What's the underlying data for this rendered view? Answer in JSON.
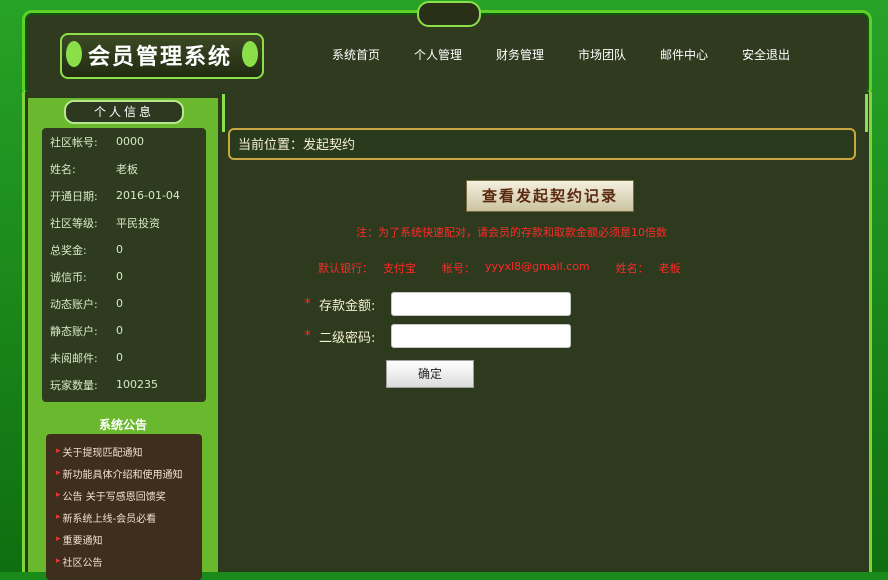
{
  "header": {
    "logo_text": "会员管理系统",
    "nav": [
      "系统首页",
      "个人管理",
      "财务管理",
      "市场团队",
      "邮件中心",
      "安全退出"
    ]
  },
  "sidebar": {
    "title": "个人信息",
    "info": [
      {
        "label": "社区帐号:",
        "value": "0000"
      },
      {
        "label": "姓名:",
        "value": "老板"
      },
      {
        "label": "开通日期:",
        "value": "2016-01-04"
      },
      {
        "label": "社区等级:",
        "value": "平民投资"
      },
      {
        "label": "总奖金:",
        "value": "0"
      },
      {
        "label": "诚信币:",
        "value": "0"
      },
      {
        "label": "动态账户:",
        "value": "0"
      },
      {
        "label": "静态账户:",
        "value": "0"
      },
      {
        "label": "未阅邮件:",
        "value": "0"
      },
      {
        "label": "玩家数量:",
        "value": "100235"
      }
    ],
    "notice_title": "系统公告",
    "notices": [
      "关于提现匹配通知",
      "新功能具体介绍和使用通知",
      "公告 关于写感恩回馈奖",
      "新系统上线-会员必看",
      "重要通知",
      "社区公告"
    ]
  },
  "content": {
    "breadcrumb": "当前位置：发起契约",
    "record_button": "查看发起契约记录",
    "note": "注：为了系统快速配对，请会员的存款和取款金额必须是10倍数",
    "bank": {
      "bank_label": "默认银行：",
      "bank_value": "支付宝",
      "account_label": "帐号：",
      "account_value": "yyyxl8@gmail.com",
      "name_label": "姓名：",
      "name_value": "老板"
    },
    "form": {
      "amount_label": "存款金额:",
      "password_label": "二级密码:",
      "submit_label": "确定"
    }
  }
}
